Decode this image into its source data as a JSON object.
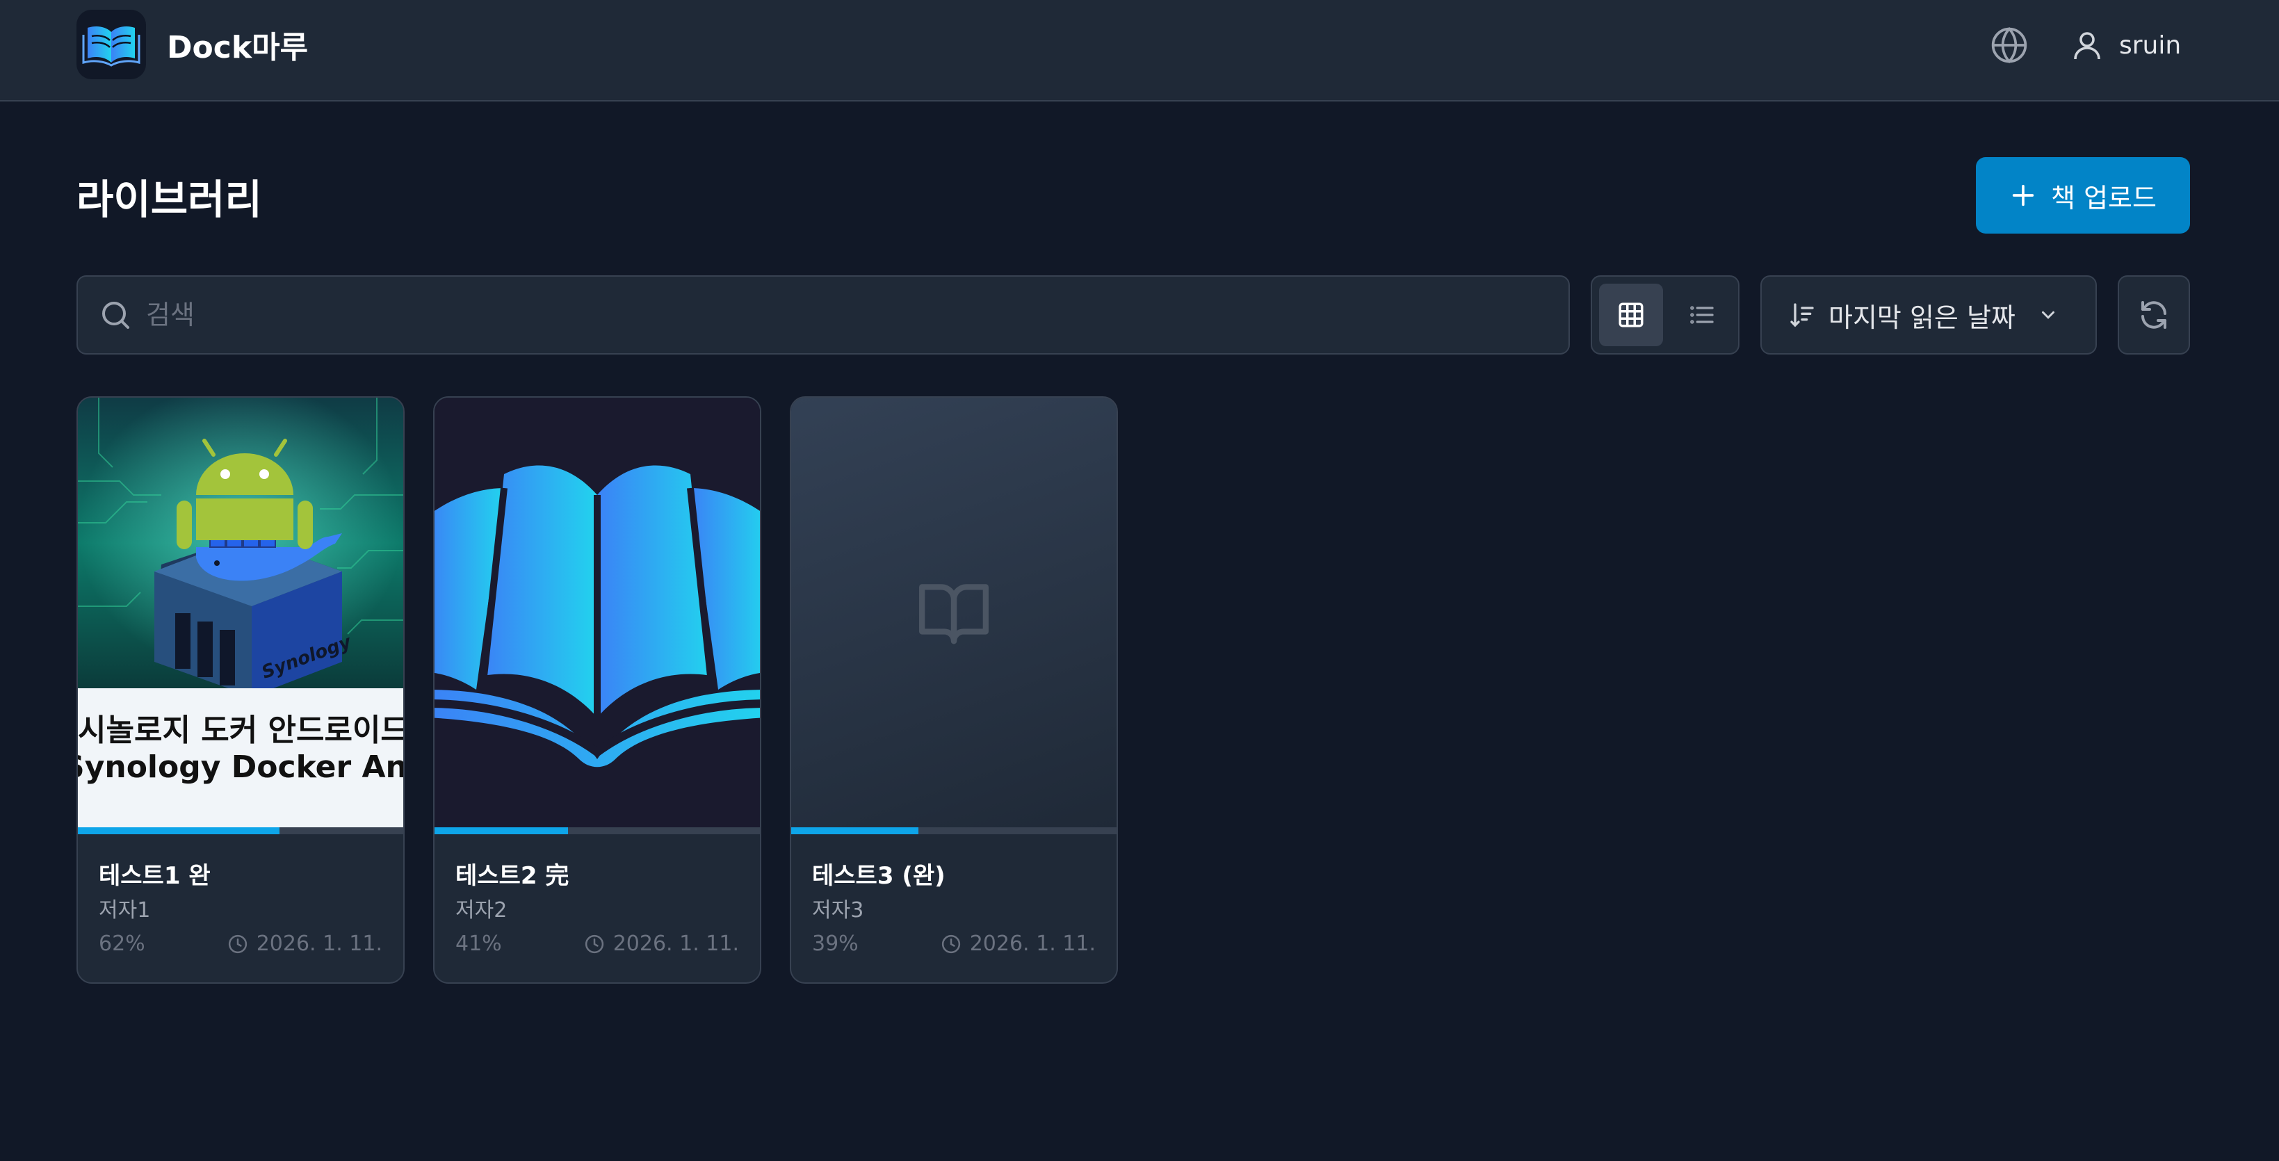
{
  "app": {
    "title": "Dock마루"
  },
  "header": {
    "user_name": "sruin"
  },
  "page": {
    "title": "라이브러리",
    "upload_label": "책 업로드"
  },
  "search": {
    "placeholder": "검색",
    "value": ""
  },
  "sort": {
    "selected": "마지막 읽은 날짜"
  },
  "colors": {
    "accent": "#0284c7",
    "progress": "#0ea5e9",
    "background": "#111827",
    "surface": "#1f2937"
  },
  "books": [
    {
      "title": "테스트1 완",
      "author": "저자1",
      "progress": 62,
      "percent_label": "62%",
      "date": "2026. 1. 11.",
      "cover_line1": "시놀로지 도커 안드로이드",
      "cover_line2": "Synology Docker Android",
      "cover_brand": "Synology"
    },
    {
      "title": "테스트2 完",
      "author": "저자2",
      "progress": 41,
      "percent_label": "41%",
      "date": "2026. 1. 11."
    },
    {
      "title": "테스트3 (완)",
      "author": "저자3",
      "progress": 39,
      "percent_label": "39%",
      "date": "2026. 1. 11."
    }
  ]
}
